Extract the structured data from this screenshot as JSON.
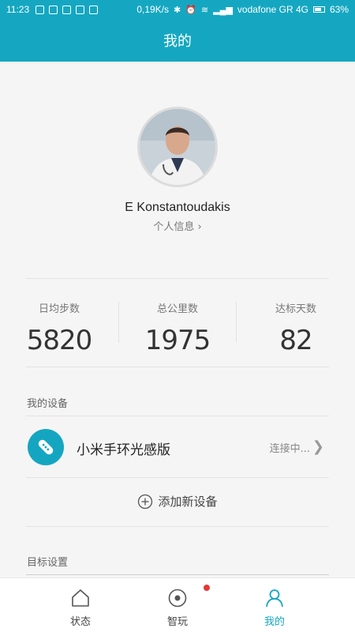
{
  "status_bar": {
    "time": "11:23",
    "speed": "0,19K/s",
    "carrier": "vodafone GR 4G",
    "battery": "63%"
  },
  "header": {
    "title": "我的"
  },
  "profile": {
    "name": "E Konstantoudakis",
    "info_link": "个人信息"
  },
  "stats": [
    {
      "label": "日均步数",
      "value": "5820"
    },
    {
      "label": "总公里数",
      "value": "1975"
    },
    {
      "label": "达标天数",
      "value": "82"
    }
  ],
  "devices": {
    "section_title": "我的设备",
    "device_name": "小米手环光感版",
    "device_status": "连接中...",
    "add_label": "添加新设备"
  },
  "goals": {
    "section_title": "目标设置"
  },
  "tabs": [
    {
      "label": "状态",
      "icon": "home-icon"
    },
    {
      "label": "智玩",
      "icon": "target-icon"
    },
    {
      "label": "我的",
      "icon": "person-icon"
    }
  ],
  "colors": {
    "accent": "#15a7c1",
    "badge": "#e53935"
  }
}
